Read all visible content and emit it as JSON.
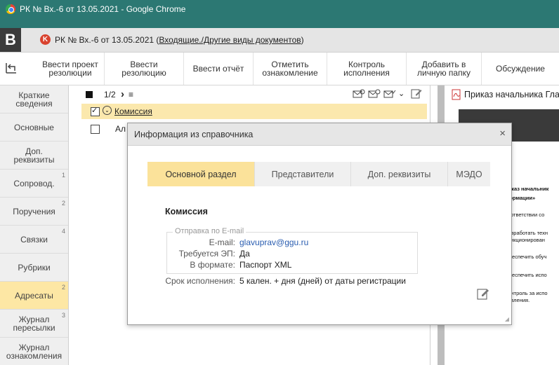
{
  "browser": {
    "title": "РК № Вх.-6 от 13.05.2021 - Google Chrome"
  },
  "header": {
    "logo": "B",
    "doc_prefix": "РК № Вх.-6 от 13.05.2021 (",
    "doc_link": "Входящие./Другие виды документов",
    "doc_suffix": ")"
  },
  "toolbar": {
    "items": [
      {
        "line1": "Ввести проект",
        "line2": "резолюции"
      },
      {
        "line1": "Ввести",
        "line2": "резолюцию"
      },
      {
        "line1": "Ввести отчёт",
        "line2": ""
      },
      {
        "line1": "Отметить",
        "line2": "ознакомление"
      },
      {
        "line1": "Контроль",
        "line2": "исполнения"
      },
      {
        "line1": "Добавить в",
        "line2": "личную папку"
      },
      {
        "line1": "Обсуждение",
        "line2": ""
      }
    ]
  },
  "sidebar": {
    "items": [
      {
        "line1": "Краткие",
        "line2": "сведения",
        "badge": ""
      },
      {
        "line1": "Основные",
        "line2": "",
        "badge": ""
      },
      {
        "line1": "Доп.",
        "line2": "реквизиты",
        "badge": ""
      },
      {
        "line1": "Сопровод.",
        "line2": "",
        "badge": "1"
      },
      {
        "line1": "Поручения",
        "line2": "",
        "badge": "2"
      },
      {
        "line1": "Связки",
        "line2": "",
        "badge": "4"
      },
      {
        "line1": "Рубрики",
        "line2": "",
        "badge": ""
      },
      {
        "line1": "Адресаты",
        "line2": "",
        "badge": "2"
      },
      {
        "line1": "Журнал",
        "line2": "пересылки",
        "badge": "3"
      },
      {
        "line1": "Журнал",
        "line2": "ознакомления",
        "badge": ""
      }
    ]
  },
  "list": {
    "pager": "1/2",
    "next": "›",
    "menu": "≡",
    "selected_row": "Комиссия",
    "row2_text": "Ал"
  },
  "preview": {
    "title": "Приказ начальника Гла",
    "lines": [
      "риказ начальник",
      "формации»",
      "соответствии со",
      "Разработать техн",
      "санкционирован",
      "Обеспечить обуч",
      "Обеспечить испо",
      "Контроль за испо",
      "равления."
    ]
  },
  "modal": {
    "title": "Информация из справочника",
    "close": "×",
    "tabs": [
      "Основной раздел",
      "Представители",
      "Доп. реквизиты",
      "МЭДО"
    ],
    "org_name": "Комиссия",
    "email_legend": "Отправка по E-mail",
    "email_label": "E-mail:",
    "email_value": "glavuprav@ggu.ru",
    "ep_label": "Требуется ЭП:",
    "ep_value": "Да",
    "format_label": "В формате:",
    "format_value": "Паспорт XML",
    "deadline_label": "Срок исполнения:",
    "deadline_value": "5 кален. + дня (дней) от даты регистрации"
  },
  "colors": {
    "chrome_bar": "#2c7873",
    "active_yellow": "#fbe29a",
    "link_blue": "#2a5db0"
  }
}
